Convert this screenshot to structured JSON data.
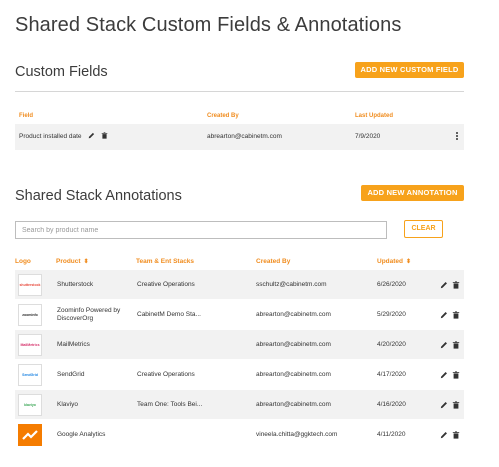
{
  "page": {
    "title": "Shared Stack Custom Fields & Annotations"
  },
  "custom_fields": {
    "title": "Custom Fields",
    "add_button": "ADD NEW CUSTOM FIELD",
    "columns": [
      "Field",
      "Created By",
      "Last Updated"
    ],
    "rows": [
      {
        "field": "Product installed date",
        "created_by": "abrearton@cabinetm.com",
        "last_updated": "7/9/2020"
      }
    ]
  },
  "annotations": {
    "title": "Shared Stack Annotations",
    "add_button": "ADD NEW ANNOTATION",
    "search_placeholder": "Search by product name",
    "clear_button": "CLEAR",
    "columns": {
      "logo": "Logo",
      "product": "Product",
      "team": "Team & Ent Stacks",
      "created_by": "Created By",
      "updated": "Updated"
    },
    "rows": [
      {
        "logo_text": "shutterstock",
        "logo_color": "#e84a3d",
        "product": "Shutterstock",
        "team": "Creative Operations",
        "created_by": "sschultz@cabinetm.com",
        "updated": "6/26/2020"
      },
      {
        "logo_text": "zoominfo",
        "logo_color": "#2a2a2a",
        "product": "Zoominfo Powered by DiscoverOrg",
        "team": "CabinetM Demo Sta...",
        "created_by": "abrearton@cabinetm.com",
        "updated": "5/29/2020"
      },
      {
        "logo_text": "MailMetrics",
        "logo_color": "#d6336c",
        "product": "MailMetrics",
        "team": "",
        "created_by": "abrearton@cabinetm.com",
        "updated": "4/20/2020"
      },
      {
        "logo_text": "SendGrid",
        "logo_color": "#1a82e2",
        "product": "SendGrid",
        "team": "Creative Operations",
        "created_by": "abrearton@cabinetm.com",
        "updated": "4/17/2020"
      },
      {
        "logo_text": "klaviyo",
        "logo_color": "#3aa655",
        "product": "Klaviyo",
        "team": "Team One: Tools Bei...",
        "created_by": "abrearton@cabinetm.com",
        "updated": "4/16/2020"
      },
      {
        "logo_text": "",
        "logo_color": "#f57c00",
        "product": "Google Analytics",
        "team": "",
        "created_by": "vineela.chitta@ggktech.com",
        "updated": "4/11/2020"
      }
    ]
  },
  "icons": [
    "pencil-icon",
    "trash-icon",
    "kebab-icon",
    "sort-icon"
  ],
  "colors": {
    "accent": "#f7a21b",
    "header_text": "#f08c1e",
    "row_shade": "#f2f2f2"
  }
}
